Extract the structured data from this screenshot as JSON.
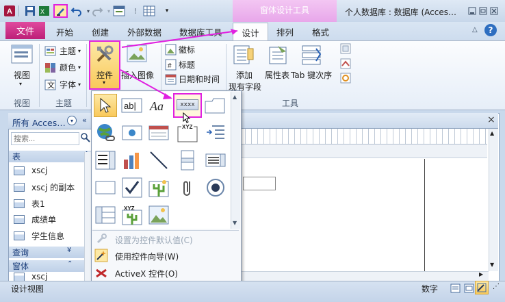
{
  "title_bar": {
    "app_title": "个人数据库 : 数据库 (Acces…",
    "context_tab_group": "窗体设计工具",
    "qa_icons": [
      "access-logo-icon",
      "save-icon",
      "excel-icon",
      "edit-icon",
      "undo-icon",
      "redo-icon",
      "form-icon",
      "alert-icon",
      "table-icon",
      "customize-icon"
    ]
  },
  "tabs": {
    "file": "文件",
    "items": [
      "开始",
      "创建",
      "外部数据",
      "数据库工具"
    ],
    "design": "设计",
    "arrange": "排列",
    "format": "格式"
  },
  "ribbon": {
    "view": {
      "label": "视图",
      "group": "视图"
    },
    "theme": {
      "theme": "主题",
      "color": "颜色",
      "font": "字体",
      "group": "主题"
    },
    "controls": {
      "label": "控件"
    },
    "insert_image": "插入图像",
    "header_footer": {
      "logo": "徽标",
      "title": "标题",
      "datetime": "日期和时间"
    },
    "tools": {
      "add_fields_line1": "添加",
      "add_fields_line2": "现有字段",
      "property_sheet": "属性表",
      "tab_order": "Tab 键次序",
      "group": "工具"
    }
  },
  "nav": {
    "title": "所有 Acces…",
    "search_placeholder": "搜索...",
    "sections": {
      "tables": "表",
      "queries": "查询",
      "forms": "窗体"
    },
    "tables": [
      "xscj",
      "xscj 的副本",
      "表1",
      "成绩单",
      "学生信息"
    ],
    "forms_partial": "xscj"
  },
  "popup": {
    "textbox_sample": "xxxx",
    "menu": {
      "set_default": "设置为控件默认值(C)",
      "use_wizard": "使用控件向导(W)",
      "activex": "ActiveX 控件(O)"
    }
  },
  "status": {
    "left": "设计视图",
    "mode": "数字"
  },
  "colors": {
    "accent_magenta": "#e020e0",
    "file_tab": "#c72a85",
    "context_tab": "#eab0ec"
  }
}
